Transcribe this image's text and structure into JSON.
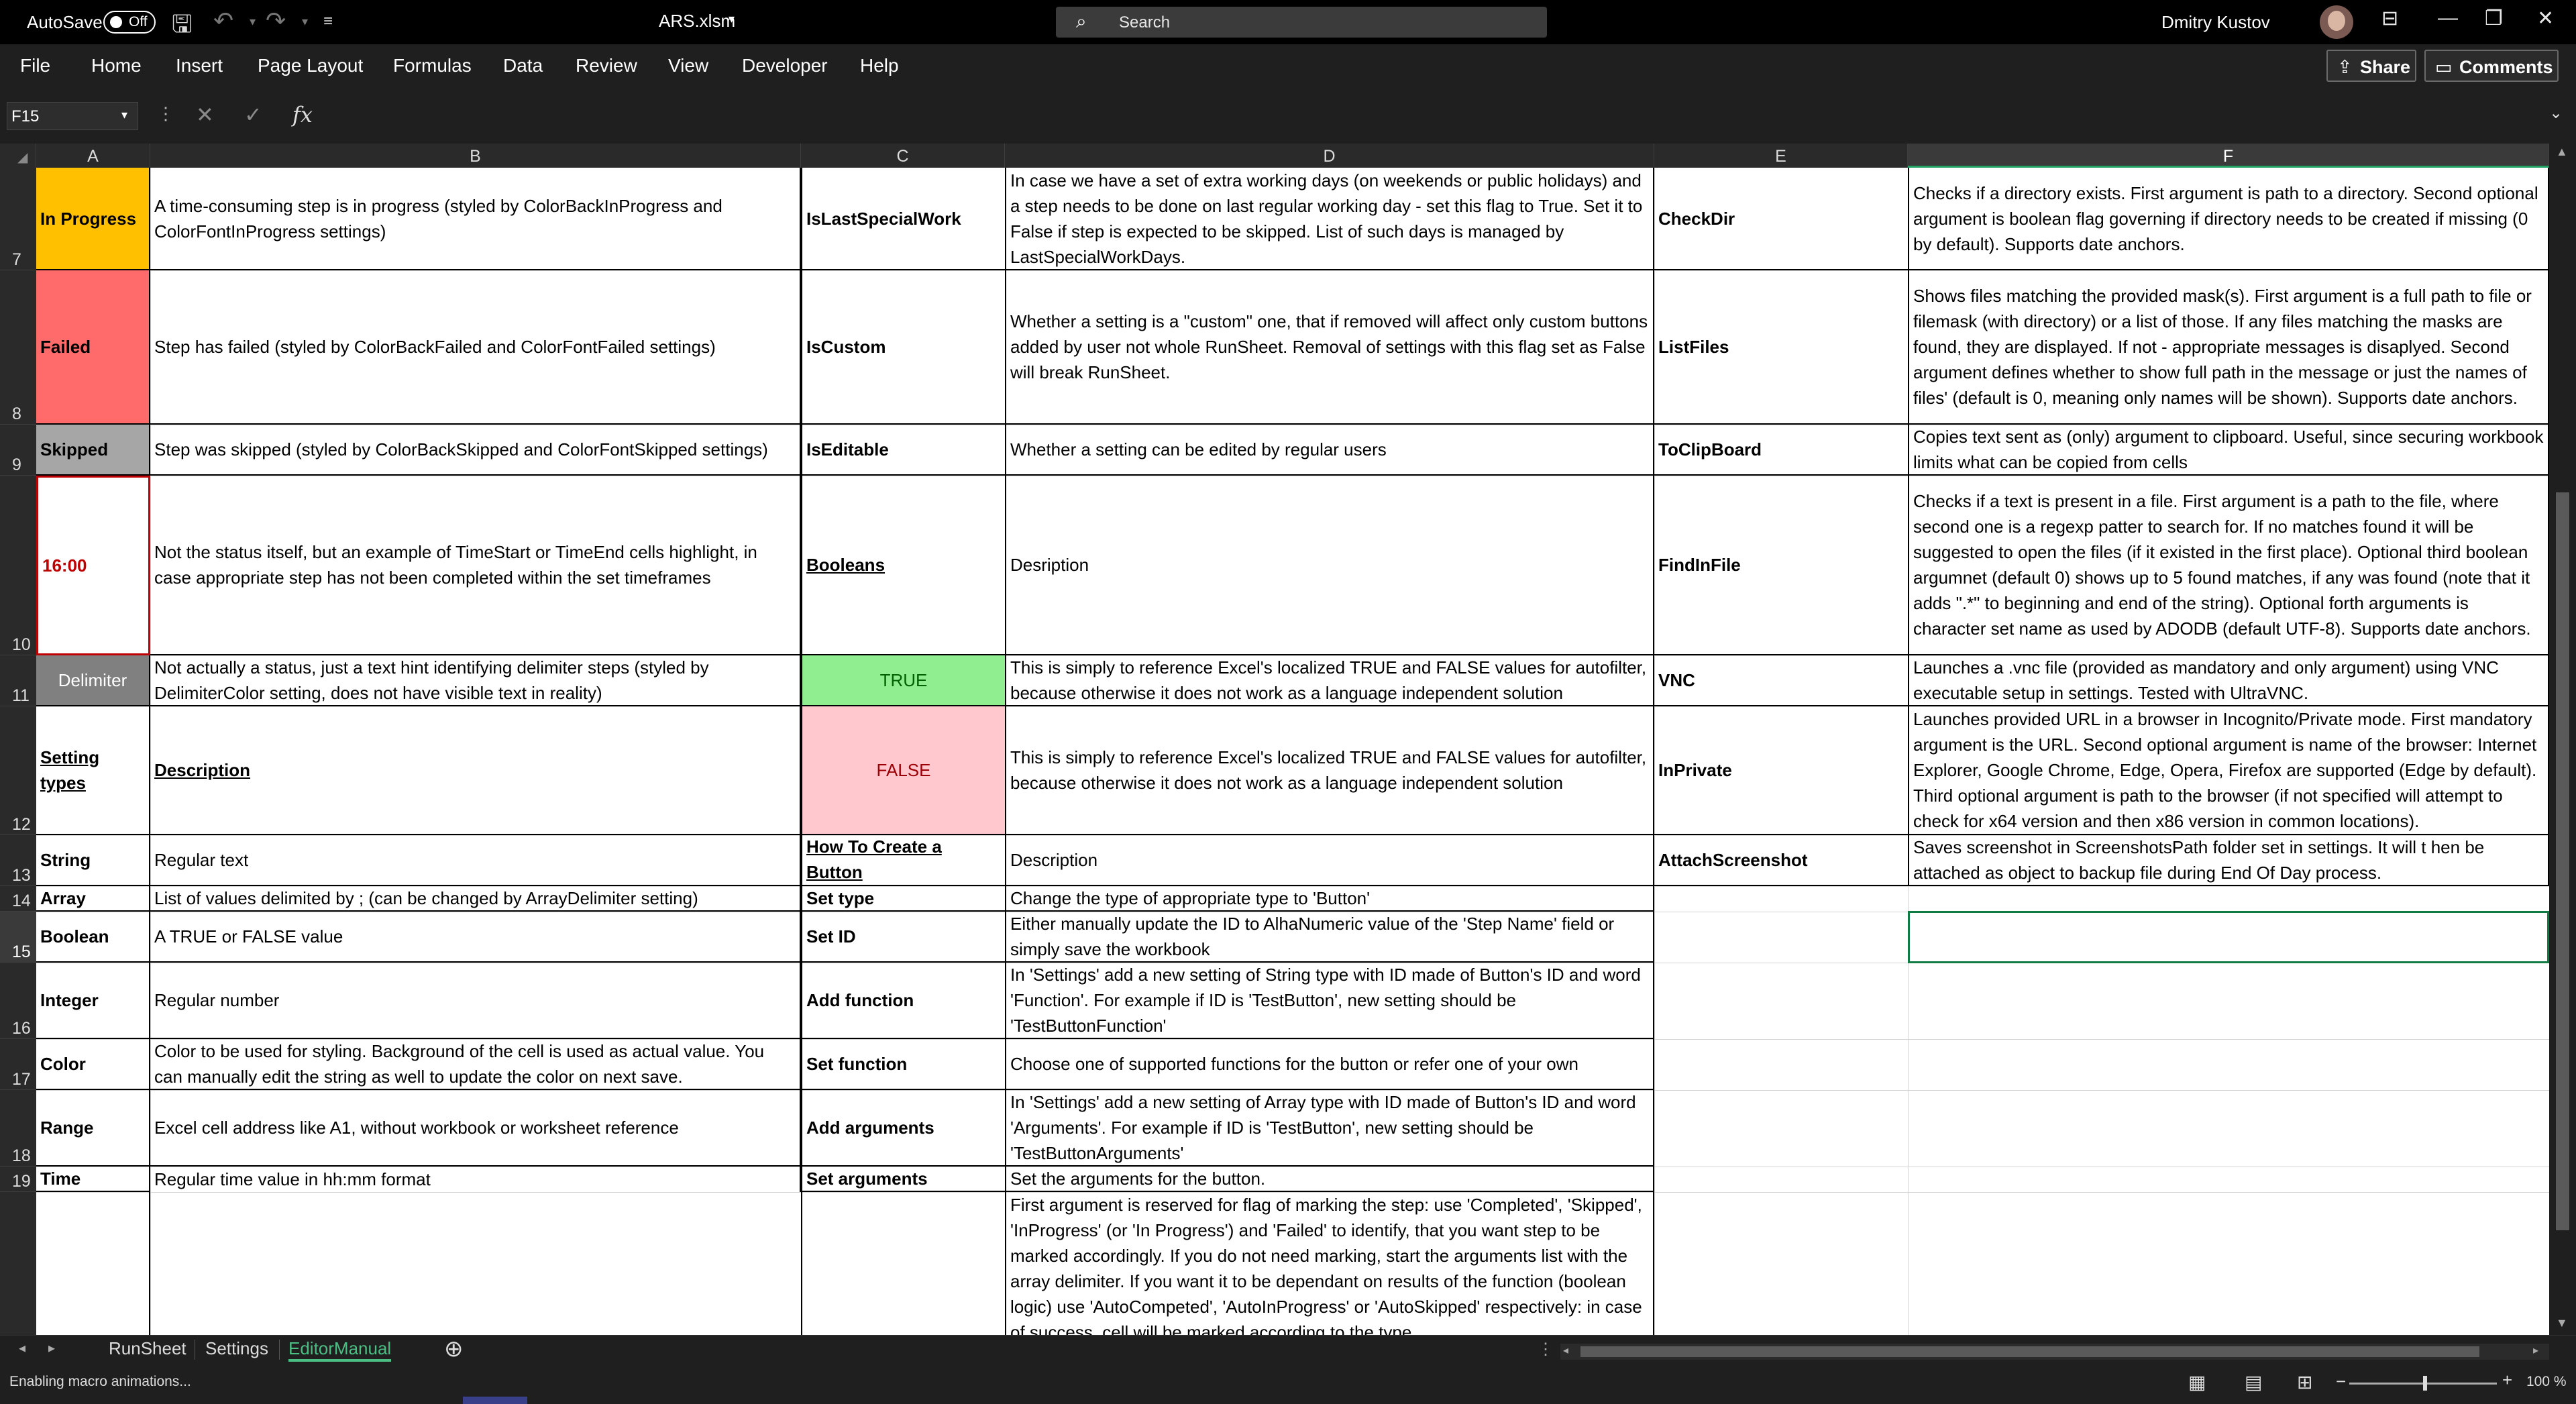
{
  "titlebar": {
    "autosave_label": "AutoSave",
    "autosave_state": "Off",
    "filename": "ARS.xlsm",
    "search_placeholder": "Search",
    "user_name": "Dmitry Kustov"
  },
  "ribbon": {
    "tabs": [
      "File",
      "Home",
      "Insert",
      "Page Layout",
      "Formulas",
      "Data",
      "Review",
      "View",
      "Developer",
      "Help"
    ],
    "share": "Share",
    "comments": "Comments"
  },
  "formula_bar": {
    "name_box": "F15",
    "fx": "fx",
    "formula": ""
  },
  "columns": [
    "A",
    "B",
    "C",
    "D",
    "E",
    "F"
  ],
  "selected_column": "F",
  "rows": [
    "7",
    "8",
    "9",
    "10",
    "11",
    "12",
    "13",
    "14",
    "15",
    "16",
    "17",
    "18",
    "19"
  ],
  "selected_row": "15",
  "cells": {
    "A7": "In Progress",
    "B7": "A time-consuming step is in progress (styled by ColorBackInProgress and ColorFontInProgress settings)",
    "C7": "IsLastSpecialWork",
    "D7": "In case we have a set of extra working days (on weekends or public holidays) and a step needs to be done on last regular working day - set this flag to True. Set it to False if step is expected to be skipped. List of such days is managed by LastSpecialWorkDays.",
    "E7": "CheckDir",
    "F7": "Checks if a directory exists. First argument is path to a directory. Second optional argument is boolean flag governing if directory needs to be created if missing (0 by default). Supports date anchors.",
    "A8": "Failed",
    "B8": "Step has failed (styled by ColorBackFailed and ColorFontFailed settings)",
    "C8": "IsCustom",
    "D8": "Whether a setting is a \"custom\" one, that if removed will affect only custom buttons added by user not whole RunSheet. Removal of settings with this flag set as False will break RunSheet.",
    "E8": "ListFiles",
    "F8": "Shows files matching the provided mask(s). First argument is a full path to file or filemask (with directory) or a list of those. If any files matching the masks are found, they are displayed. If not - appropriate messages is disaplyed. Second argument defines whether to show full path in the message or just the names of files' (default is 0, meaning only names will be shown). Supports date anchors.",
    "A9": "Skipped",
    "B9": "Step was skipped (styled by ColorBackSkipped and ColorFontSkipped settings)",
    "C9": "IsEditable",
    "D9": "Whether a setting can be edited by regular users",
    "E9": "ToClipBoard",
    "F9": "Copies text sent as (only) argument to clipboard. Useful, since securing workbook limits what can be copied from cells",
    "A10": "16:00",
    "B10": "Not the status itself, but an example of TimeStart or TimeEnd cells highlight, in case appropriate step has not been completed within the set timeframes",
    "C10": "Booleans",
    "D10": "Desription",
    "E10": "FindInFile",
    "F10": "Checks if a text is present in a file. First argument is a path to the file, where second one is a regexp patter to search for. If no matches found it will be suggested to open the files (if it existed in the first place). Optional third boolean argumnet (default 0) shows up to 5 found matches, if any was found (note that it adds \".*\" to beginning and end of the string). Optional forth arguments is character set name as used by ADODB (default UTF-8). Supports date anchors.",
    "A11": "Delimiter",
    "B11": "Not actually a status, just a text hint identifying delimiter steps (styled by DelimiterColor setting, does not have visible text in reality)",
    "C11": "TRUE",
    "D11": "This is simply to reference Excel's localized TRUE and FALSE values for autofilter, because otherwise it does not work as a language independent solution",
    "E11": "VNC",
    "F11": "Launches a .vnc file (provided as mandatory and only argument) using VNC executable setup in settings. Tested with UltraVNC.",
    "A12": "Setting types",
    "B12": "Description",
    "C12": "FALSE",
    "D12": "This is simply to reference Excel's localized TRUE and FALSE values for autofilter, because otherwise it does not work as a language independent solution",
    "E12": "InPrivate",
    "F12": "Launches provided URL in a browser in Incognito/Private mode. First mandatory argument is the URL. Second optional argument is name of the browser: Internet Explorer, Google Chrome, Edge, Opera, Firefox are supported (Edge by default). Third optional argument is path to the browser (if not specified will attempt to check for x64 version and then x86 version in common locations).",
    "A13": "String",
    "B13": "Regular text",
    "C13": "How To Create a Button",
    "D13": "Description",
    "E13": "AttachScreenshot",
    "F13": "Saves screenshot in ScreenshotsPath folder set in settings. It will t hen be attached as object to backup file during End Of Day process.",
    "A14": "Array",
    "B14": "List of values delimited by ; (can be changed by ArrayDelimiter setting)",
    "C14": "Set type",
    "D14": "Change the type of appropriate type to 'Button'",
    "A15": "Boolean",
    "B15": "A TRUE or FALSE value",
    "C15": "Set ID",
    "D15": "Either manually update the ID to AlhaNumeric value of the 'Step Name' field or simply save the workbook",
    "A16": "Integer",
    "B16": "Regular number",
    "C16": "Add function",
    "D16": "In 'Settings' add a new setting of String type with ID made of Button's ID and word 'Function'. For example if ID is 'TestButton', new setting should be 'TestButtonFunction'",
    "A17": "Color",
    "B17": "Color to be used for styling. Background of the cell is used as actual value. You can manually edit the string as well to update the color on next save.",
    "C17": "Set function",
    "D17": "Choose one of supported functions for the button or refer one of your own",
    "A18": "Range",
    "B18": "Excel cell address like A1, without workbook or worksheet reference",
    "C18": "Add arguments",
    "D18": "In 'Settings' add a new setting of Array type with ID made of Button's ID and word 'Arguments'. For example if ID is 'TestButton', new setting should be 'TestButtonArguments'",
    "A19": "Time",
    "B19": "Regular time value in hh:mm format",
    "C19": "Set arguments",
    "D19": "Set the arguments for the button.",
    "D20": "First argument is reserved for flag of marking the step: use 'Completed', 'Skipped', 'InProgress' (or 'In Progress') and 'Failed' to identify, that you want step to be marked accordingly. If you do not need marking, start the arguments list with the array delimiter. If you want it to be dependant on results of the function (boolean logic) use 'AutoCompeted', 'AutoInProgress' or 'AutoSkipped' respectively: in case of success, cell will be marked according to the type"
  },
  "colors": {
    "in_progress": "#FFC000",
    "failed": "#FF6B6B",
    "skipped": "#A6A6A6",
    "delimiter": "#808080",
    "true_fill": "#90EE90",
    "false_fill": "#FFC7CE",
    "time_highlight": "#C00000",
    "accent": "#21A366"
  },
  "sheet_tabs": [
    "RunSheet",
    "Settings",
    "EditorManual"
  ],
  "active_sheet": "EditorManual",
  "status": {
    "message": "Enabling macro animations...",
    "zoom": "100 %"
  }
}
